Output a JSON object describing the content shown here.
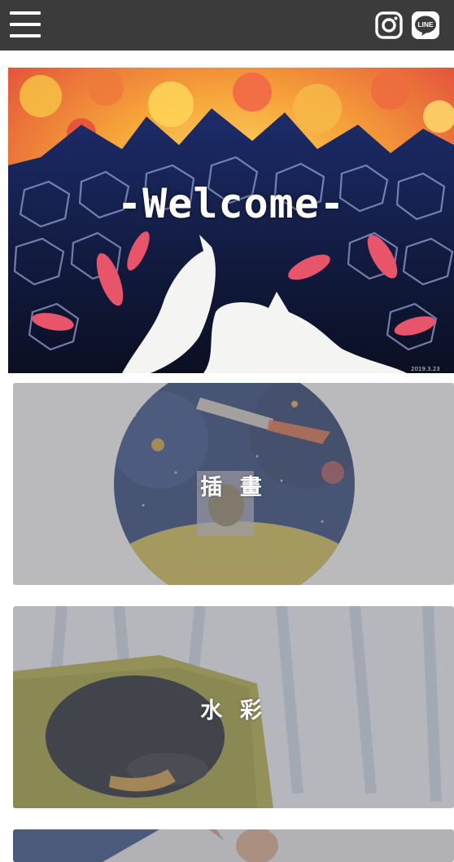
{
  "header": {
    "menu_icon": "hamburger-menu-icon",
    "social": [
      {
        "icon": "instagram-icon"
      },
      {
        "icon": "line-icon",
        "label": "LINE"
      }
    ],
    "background": "#3b3b3b"
  },
  "hero": {
    "title": "-Welcome-",
    "signature": "2019.3.23"
  },
  "categories": [
    {
      "title": "插 畫"
    },
    {
      "title": "水 彩"
    },
    {
      "title": ""
    }
  ]
}
